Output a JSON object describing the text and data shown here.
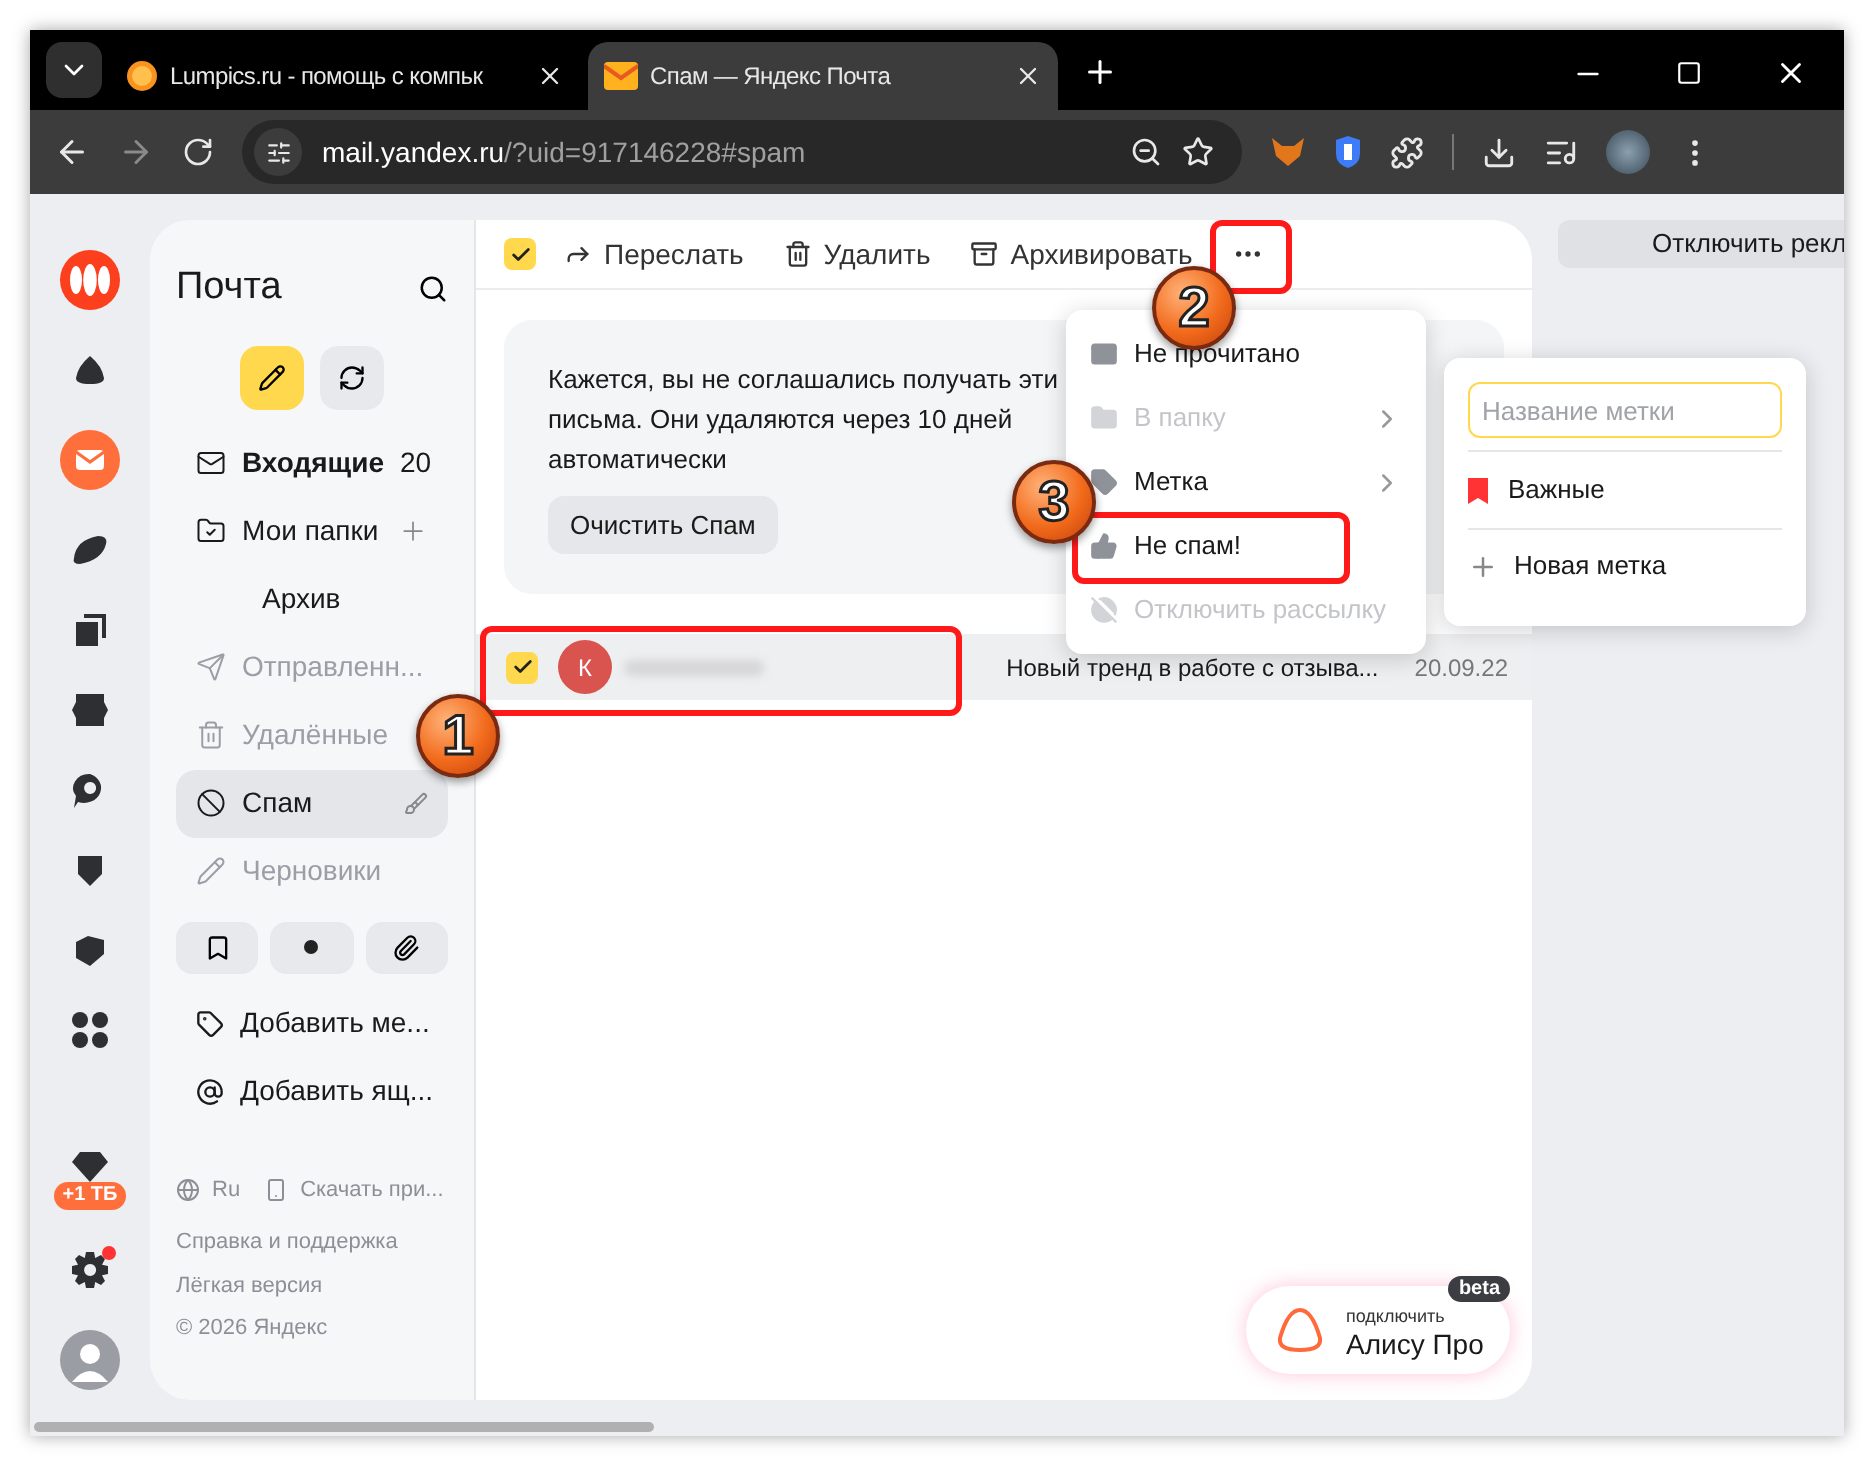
{
  "browser": {
    "tabs": [
      {
        "title": "Lumpics.ru - помощь с компьк",
        "selected": false
      },
      {
        "title": "Спам — Яндекс Почта",
        "selected": true
      }
    ],
    "address": {
      "host": "mail.yandex.ru",
      "path": "/?uid=917146228#spam"
    }
  },
  "rail": {
    "storage_badge": "+1 ТБ",
    "settings_alert": true
  },
  "sidebar": {
    "title": "Почта",
    "folders": [
      {
        "label": "Входящие",
        "count": "20",
        "unread": true,
        "dimmed": false,
        "selected": false,
        "clearable": false
      },
      {
        "label": "Мои папки",
        "unread": false,
        "dimmed": false,
        "selected": false,
        "clearable": false,
        "children": [
          {
            "label": "Архив",
            "unread": false,
            "dimmed": false,
            "selected": false,
            "clearable": false
          }
        ]
      },
      {
        "label": "Отправленн...",
        "unread": false,
        "dimmed": true,
        "selected": false,
        "clearable": false
      },
      {
        "label": "Удалённые",
        "unread": false,
        "dimmed": true,
        "selected": false,
        "clearable": false
      },
      {
        "label": "Спам",
        "unread": false,
        "dimmed": false,
        "selected": true,
        "clearable": true
      },
      {
        "label": "Черновики",
        "unread": false,
        "dimmed": true,
        "selected": false,
        "clearable": false
      }
    ],
    "actions": [
      "Добавить ме...",
      "Добавить ящ..."
    ],
    "footer": {
      "language": "Ru",
      "download": "Скачать при...",
      "links": [
        "Справка и поддержка",
        "Лёгкая версия",
        "© 2026 Яндекс"
      ]
    }
  },
  "toolbar": {
    "select_all": {
      "checked": true
    },
    "actions": [
      "Переслать",
      "Удалить",
      "Архивировать"
    ]
  },
  "notice": {
    "text": "Кажется, вы не соглашались получать эти письма. Они удаляются через 10 дней автоматически",
    "button": "Очистить Спам"
  },
  "messages": [
    {
      "checked": true,
      "avatar": "К",
      "subject": "Новый тренд в работе с отзыва...",
      "date": "20.09.22"
    }
  ],
  "menu": {
    "items": [
      {
        "label": "Не прочитано",
        "disabled": false,
        "submenu": false
      },
      {
        "label": "В папку",
        "disabled": true,
        "submenu": true
      },
      {
        "label": "Метка",
        "disabled": false,
        "submenu": true
      },
      {
        "label": "Не спам!",
        "disabled": false,
        "submenu": false
      },
      {
        "label": "Отключить рассылку",
        "disabled": true,
        "submenu": false
      }
    ]
  },
  "label_menu": {
    "placeholder": "Название метки",
    "labels": [
      {
        "name": "Важные",
        "color": "#ff3333"
      }
    ],
    "new_label": "Новая метка"
  },
  "ad_button": "Отключить рекл",
  "alice": {
    "caption": "подключить",
    "title": "Алису Про",
    "badge": "beta"
  },
  "annotations": [
    "1",
    "2",
    "3"
  ]
}
